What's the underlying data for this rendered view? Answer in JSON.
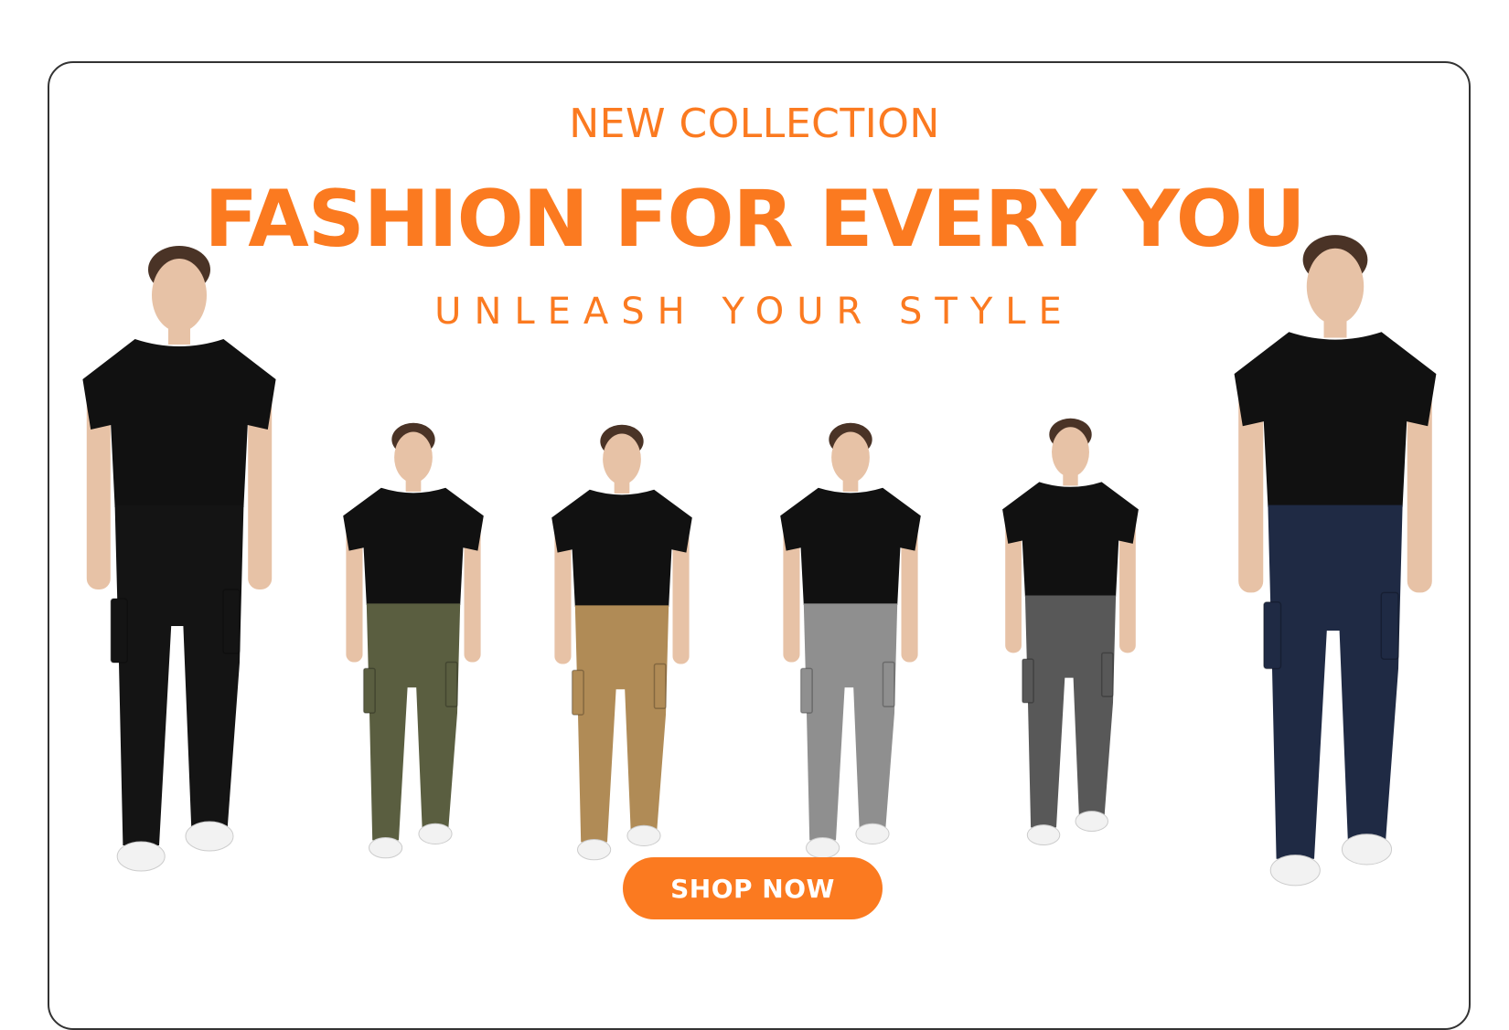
{
  "hero": {
    "eyebrow": "NEW COLLECTION",
    "headline": "FASHION FOR EVERY YOU",
    "tagline": "UNLEASH YOUR STYLE",
    "cta_label": "SHOP NOW"
  },
  "colors": {
    "accent": "#fb7a20",
    "border": "#333333",
    "skin": "#e7c2a6",
    "hair": "#4a3326",
    "shirt": "#111111",
    "sneaker": "#f2f2f2"
  },
  "models": [
    {
      "name": "model-black-pants",
      "pants": "#141414"
    },
    {
      "name": "model-olive-pants",
      "pants": "#5a5e40"
    },
    {
      "name": "model-khaki-pants",
      "pants": "#b08b56"
    },
    {
      "name": "model-light-grey-pants",
      "pants": "#8f8f8f"
    },
    {
      "name": "model-charcoal-pants",
      "pants": "#585858"
    },
    {
      "name": "model-navy-pants",
      "pants": "#1f2a44"
    }
  ]
}
